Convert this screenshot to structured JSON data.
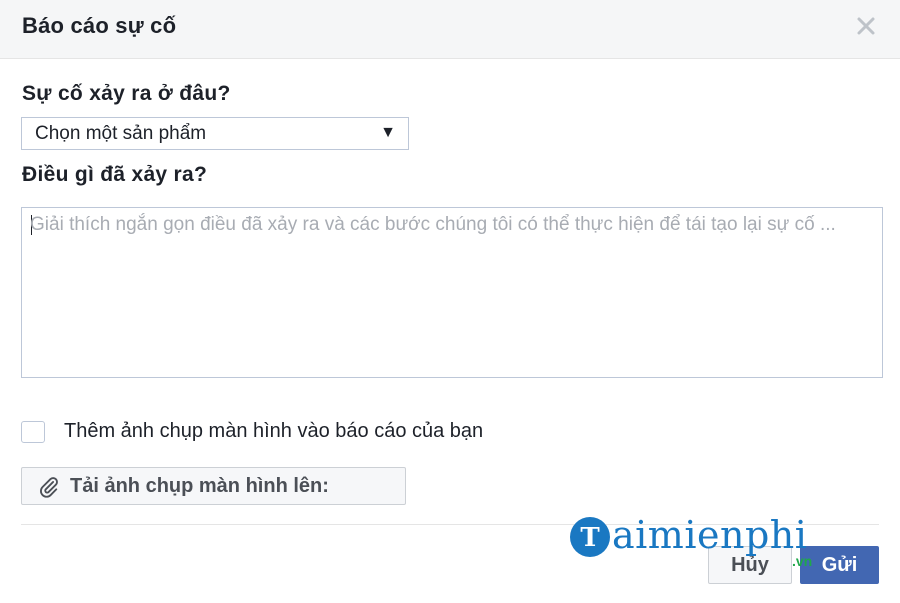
{
  "dialog": {
    "title": "Báo cáo sự cố",
    "close_icon": "close-icon"
  },
  "location_question": {
    "label": "Sự cố xảy ra ở đâu?",
    "select_value": "Chọn một sản phẩm",
    "select_arrow": "▼"
  },
  "description_question": {
    "label": "Điều gì đã xảy ra?",
    "placeholder": "Giải thích ngắn gọn điều đã xảy ra và các bước chúng tôi có thể thực hiện để tái tạo lại sự cố ..."
  },
  "screenshot_option": {
    "checked": false,
    "label": "Thêm ảnh chụp màn hình vào báo cáo của bạn"
  },
  "upload": {
    "label": "Tải ảnh chụp màn hình lên:",
    "icon": "paperclip-icon"
  },
  "footer": {
    "cancel_label": "Hủy",
    "send_label": "Gửi"
  },
  "watermark": {
    "text": "aimienphi",
    "logo_letter": "T",
    "tld": ".vn"
  },
  "colors": {
    "header_bg": "#f5f6f7",
    "primary_button": "#4267b2",
    "border": "#bdc7d8",
    "watermark_blue": "#1a78c2",
    "watermark_green": "#1fa84a"
  }
}
